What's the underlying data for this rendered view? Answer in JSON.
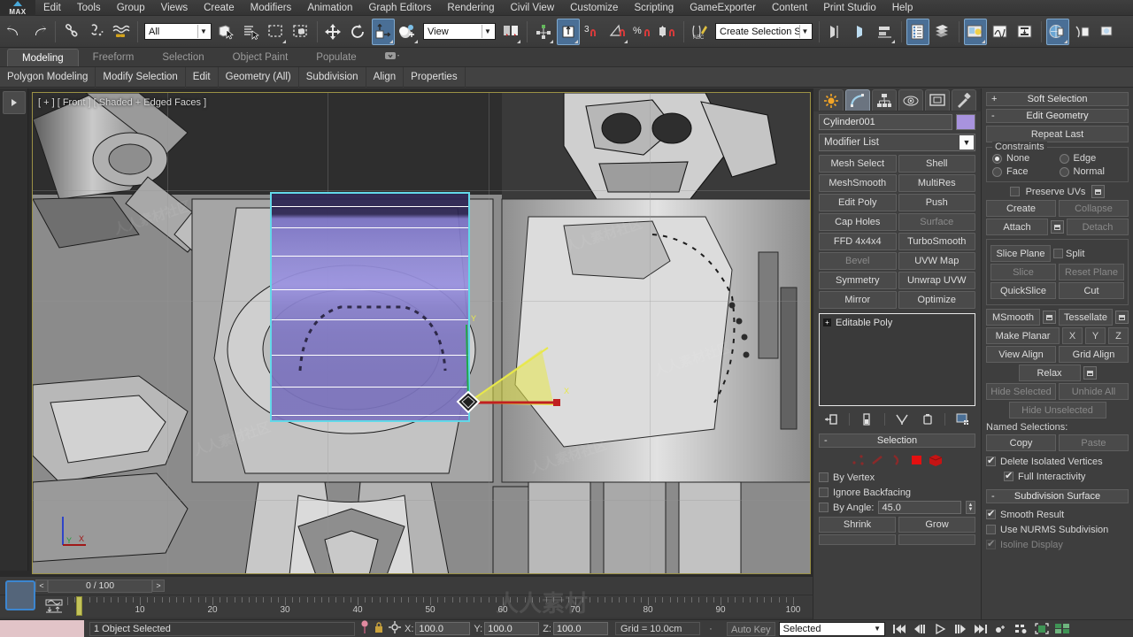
{
  "app": {
    "logo": "MAX"
  },
  "menu": {
    "items": [
      "Edit",
      "Tools",
      "Group",
      "Views",
      "Create",
      "Modifiers",
      "Animation",
      "Graph Editors",
      "Rendering",
      "Civil View",
      "Customize",
      "Scripting",
      "GameExporter",
      "Content",
      "Print Studio",
      "Help"
    ]
  },
  "toolbar": {
    "selection_filter": "All",
    "reference_coord": "View",
    "selection_set": "Create Selection Se",
    "angle_snap_value": "3",
    "icons": [
      "undo-icon",
      "redo-icon",
      "select-link-icon",
      "unlink-icon",
      "bind-space-warp-icon",
      "select-object-icon",
      "select-by-name-icon",
      "rectangular-select-icon",
      "window-crossing-icon",
      "select-move-icon",
      "select-rotate-icon",
      "select-scale-icon",
      "use-center-icon",
      "mirror-icon",
      "align-icon",
      "snap-toggle-icon",
      "angle-snap-icon",
      "percent-snap-icon",
      "spinner-snap-icon",
      "edit-named-selection-icon",
      "manage-layers-icon",
      "ribbon-icon",
      "curve-editor-icon",
      "schematic-view-icon",
      "material-editor-icon",
      "render-setup-icon",
      "render-frame-icon",
      "render-production-icon"
    ]
  },
  "ribbon": {
    "tabs": [
      "Modeling",
      "Freeform",
      "Selection",
      "Object Paint",
      "Populate"
    ],
    "selected_tab": "Modeling",
    "subtabs": [
      "Polygon Modeling",
      "Modify Selection",
      "Edit",
      "Geometry (All)",
      "Subdivision",
      "Align",
      "Properties"
    ]
  },
  "viewport": {
    "label": "[ + ] [ Front ] [ Shaded + Edged Faces ]",
    "axis": {
      "x": "X",
      "y": "Y",
      "z": "Z"
    }
  },
  "timeslider": {
    "frame": "0 / 100",
    "prev": "<",
    "next": ">",
    "ticks": [
      "10",
      "20",
      "30",
      "40",
      "50",
      "60",
      "70",
      "80",
      "90",
      "100"
    ]
  },
  "command_panel": {
    "tabs": [
      "create-tab-icon",
      "modify-tab-icon",
      "hierarchy-tab-icon",
      "motion-tab-icon",
      "display-tab-icon",
      "utilities-tab-icon"
    ],
    "selected_tab_index": 1,
    "object_name": "Cylinder001",
    "object_color": "#a893de",
    "modifier_list_label": "Modifier List",
    "modifier_buttons": [
      "Mesh Select",
      "Shell",
      "MeshSmooth",
      "MultiRes",
      "Edit Poly",
      "Push",
      "Cap Holes",
      "Surface",
      "FFD 4x4x4",
      "TurboSmooth",
      "Bevel",
      "UVW Map",
      "Symmetry",
      "Unwrap UVW",
      "Mirror",
      "Optimize"
    ],
    "stack": [
      "Editable Poly"
    ],
    "stack_tools": [
      "pin-stack-icon",
      "show-end-result-icon",
      "make-unique-icon",
      "remove-modifier-icon",
      "configure-sets-icon"
    ],
    "selection_rollout": {
      "title": "Selection",
      "sign": "-",
      "sub_object_icons": [
        "vertex-icon",
        "edge-icon",
        "border-icon",
        "polygon-icon",
        "element-icon"
      ],
      "by_vertex": "By Vertex",
      "ignore_backfacing": "Ignore Backfacing",
      "by_angle": "By Angle:",
      "by_angle_value": "45.0",
      "shrink": "Shrink",
      "grow": "Grow"
    }
  },
  "right_panel": {
    "soft_selection": {
      "title": "Soft Selection",
      "sign": "+"
    },
    "edit_geometry": {
      "title": "Edit Geometry",
      "sign": "-",
      "repeat_last": "Repeat Last",
      "constraints_label": "Constraints",
      "constraints": [
        "None",
        "Edge",
        "Face",
        "Normal"
      ],
      "constraint_selected": "None",
      "preserve_uvs": "Preserve UVs",
      "create": "Create",
      "collapse": "Collapse",
      "attach": "Attach",
      "detach": "Detach",
      "slice_plane": "Slice Plane",
      "split": "Split",
      "slice": "Slice",
      "reset_plane": "Reset Plane",
      "quickslice": "QuickSlice",
      "cut": "Cut",
      "msmooth": "MSmooth",
      "tessellate": "Tessellate",
      "make_planar": "Make Planar",
      "axis_x": "X",
      "axis_y": "Y",
      "axis_z": "Z",
      "view_align": "View Align",
      "grid_align": "Grid Align",
      "relax": "Relax",
      "hide_selected": "Hide Selected",
      "unhide_all": "Unhide All",
      "hide_unselected": "Hide Unselected",
      "named_selections": "Named Selections:",
      "copy": "Copy",
      "paste": "Paste",
      "delete_isolated_vertices": "Delete Isolated Vertices",
      "full_interactivity": "Full Interactivity"
    },
    "subdivision_surface": {
      "title": "Subdivision Surface",
      "sign": "-",
      "smooth_result": "Smooth Result",
      "use_nurms": "Use NURMS Subdivision",
      "isoline_display": "Isoline Display"
    }
  },
  "status_bar": {
    "message": "1 Object Selected",
    "x_label": "X:",
    "x_value": "100.0",
    "y_label": "Y:",
    "y_value": "100.0",
    "z_label": "Z:",
    "z_value": "100.0",
    "grid": "Grid = 10.0cm",
    "auto_key": "Auto Key",
    "key_filter": "Selected",
    "playback_icons": [
      "goto-start-icon",
      "prev-frame-icon",
      "play-icon",
      "next-frame-icon",
      "goto-end-icon",
      "key-mode-icon",
      "set-key-icon",
      "zoom-extents-icon",
      "zoom-all-icon"
    ]
  },
  "watermark": "人人素材社区"
}
